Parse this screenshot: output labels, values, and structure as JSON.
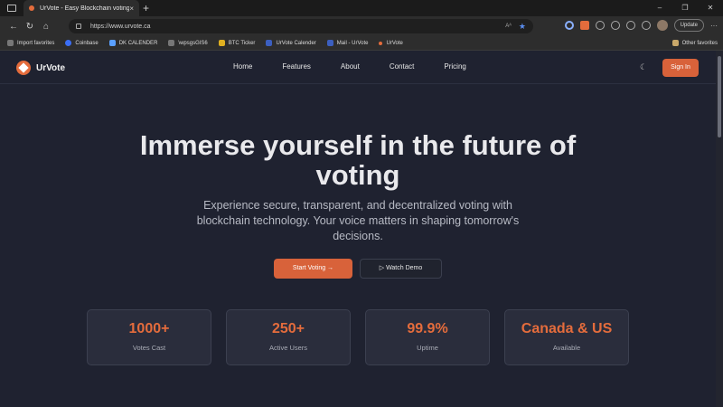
{
  "browser": {
    "tab_title": "UrVote - Easy Blockchain voting",
    "tab_close": "×",
    "new_tab": "+",
    "window_controls": [
      "–",
      "❐",
      "✕"
    ],
    "url": "https://www.urvote.ca",
    "read_aloud": "Aᴬ",
    "update_label": "Update",
    "more": "···",
    "bookmarks": [
      {
        "label": "Import favorites",
        "icon": "import-icon"
      },
      {
        "label": "Coinbase",
        "icon": "coinbase-icon"
      },
      {
        "label": "DK CALENDER",
        "icon": "dk-icon"
      },
      {
        "label": "\\wpsgsGIS6",
        "icon": "wpsg-icon"
      },
      {
        "label": "BTC Ticker",
        "icon": "btc-icon"
      },
      {
        "label": "UrVote Calender",
        "icon": "urvote-calendar-icon"
      },
      {
        "label": "Mail - UrVote",
        "icon": "mail-icon"
      },
      {
        "label": "UrVote",
        "icon": "urvote-icon"
      }
    ],
    "other_favorites": "Other favorites"
  },
  "site": {
    "logo_text": "UrVote",
    "nav": {
      "home": "Home",
      "features": "Features",
      "about": "About",
      "contact": "Contact",
      "pricing": "Pricing"
    },
    "theme_toggle_icon": "☾",
    "sign_in": "Sign In"
  },
  "hero": {
    "title_line1": "Immerse yourself in the future of",
    "title_line2": "voting",
    "subtitle": "Experience secure, transparent, and decentralized voting with blockchain technology. Your voice matters in shaping tomorrow's decisions.",
    "cta_primary": "Start Voting  →",
    "cta_secondary": "▷  Watch Demo"
  },
  "stats": [
    {
      "value": "1000+",
      "label": "Votes Cast"
    },
    {
      "value": "250+",
      "label": "Active Users"
    },
    {
      "value": "99.9%",
      "label": "Uptime"
    },
    {
      "value": "Canada & US",
      "label": "Available"
    }
  ],
  "colors": {
    "accent": "#e46c3c",
    "background": "#1f2230",
    "card": "#2a2d3c"
  }
}
